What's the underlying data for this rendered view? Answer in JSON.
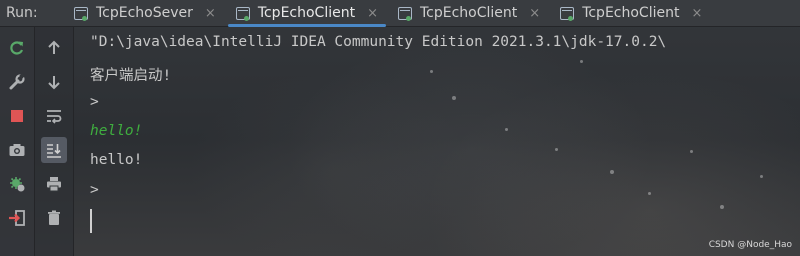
{
  "run_panel": {
    "label": "Run:",
    "tabs": [
      {
        "label": "TcpEchoSever",
        "active": false
      },
      {
        "label": "TcpEchoClient",
        "active": true
      },
      {
        "label": "TcpEchoClient",
        "active": false
      },
      {
        "label": "TcpEchoClient",
        "active": false
      }
    ],
    "close_glyph": "×"
  },
  "toolbar_left": [
    {
      "name": "rerun-icon",
      "selected": false
    },
    {
      "name": "wrench-icon",
      "selected": false
    },
    {
      "name": "stop-icon",
      "selected": false
    },
    {
      "name": "camera-icon",
      "selected": false
    },
    {
      "name": "debug-settings-icon",
      "selected": false
    },
    {
      "name": "exit-icon",
      "selected": false
    }
  ],
  "toolbar_right": [
    {
      "name": "arrow-up-icon",
      "selected": false
    },
    {
      "name": "arrow-down-icon",
      "selected": false
    },
    {
      "name": "soft-wrap-icon",
      "selected": false
    },
    {
      "name": "scroll-to-end-icon",
      "selected": true
    },
    {
      "name": "print-icon",
      "selected": false
    },
    {
      "name": "trash-icon",
      "selected": false
    }
  ],
  "console": {
    "lines": [
      {
        "text": "\"D:\\java\\idea\\IntelliJ IDEA Community Edition 2021.3.1\\jdk-17.0.2\\",
        "kind": "output"
      },
      {
        "text": "客户端启动!",
        "kind": "output"
      },
      {
        "text": ">",
        "kind": "prompt"
      },
      {
        "text": "hello!",
        "kind": "input"
      },
      {
        "text": "hello!",
        "kind": "output"
      },
      {
        "text": ">",
        "kind": "prompt"
      }
    ]
  },
  "watermark": "CSDN @Node_Hao",
  "colors": {
    "accent": "#4a88c7",
    "user_input": "#3fae3f",
    "stop_red": "#e05555",
    "rerun_green": "#59a869"
  }
}
